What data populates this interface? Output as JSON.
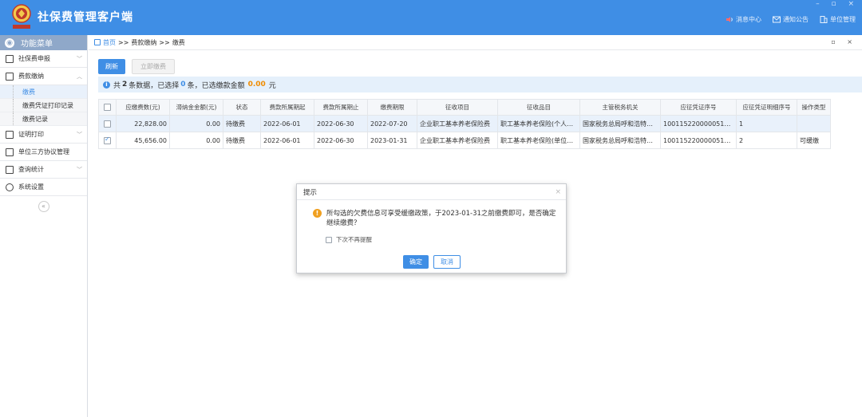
{
  "header": {
    "title": "社保费管理客户端",
    "window_controls": "– ▫ ×",
    "actions": [
      {
        "label": "消息中心",
        "icon": "bell-icon"
      },
      {
        "label": "通知公告",
        "icon": "mail-icon"
      },
      {
        "label": "单位管理",
        "icon": "building-icon"
      }
    ],
    "accent": "#3f8ee5"
  },
  "sidebar": {
    "title": "功能菜单",
    "items": [
      {
        "label": "社保费申报",
        "icon": "declare-icon",
        "expanded": false
      },
      {
        "label": "费款缴纳",
        "icon": "payment-icon",
        "expanded": true,
        "children": [
          {
            "label": "缴费",
            "current": true
          },
          {
            "label": "缴费凭证打印记录",
            "current": false
          },
          {
            "label": "缴费记录",
            "current": false
          }
        ]
      },
      {
        "label": "证明打印",
        "icon": "print-icon",
        "expanded": false
      },
      {
        "label": "单位三方协议管理",
        "icon": "agreement-icon",
        "expanded": false
      },
      {
        "label": "查询统计",
        "icon": "stats-icon",
        "expanded": false
      },
      {
        "label": "系统设置",
        "icon": "gear-icon",
        "expanded": false
      }
    ]
  },
  "breadcrumb": {
    "home": "首页",
    "sep": ">>",
    "level1": "费款缴纳",
    "level2": "缴费",
    "panel_controls": "▫ ×"
  },
  "toolbar": {
    "refresh": "刷新",
    "pay_now": "立即缴费"
  },
  "summary": {
    "prefix": "共",
    "total": "2",
    "mid1": "条数据，已选择",
    "selected": "0",
    "mid2": "条，已选缴款金额",
    "amount": "0.00",
    "suffix": "元"
  },
  "table": {
    "columns": [
      "应缴费数(元)",
      "滞纳金金额(元)",
      "状态",
      "费款所属期起",
      "费款所属期止",
      "缴费期限",
      "征收项目",
      "征收品目",
      "主管税务机关",
      "应征凭证序号",
      "应征凭证明细序号",
      "操作类型"
    ],
    "rows": [
      {
        "checked": false,
        "highlight": true,
        "cells": [
          "22,828.00",
          "0.00",
          "待缴费",
          "2022-06-01",
          "2022-06-30",
          "2022-07-20",
          "企业职工基本养老保险费",
          "职工基本养老保险(个人缴纳)",
          "国家税务总局呼和浩特市新...",
          "1001152200000515...",
          "1",
          ""
        ]
      },
      {
        "checked": true,
        "highlight": false,
        "cells": [
          "45,656.00",
          "0.00",
          "待缴费",
          "2022-06-01",
          "2022-06-30",
          "2023-01-31",
          "企业职工基本养老保险费",
          "职工基本养老保险(单位缴纳)",
          "国家税务总局呼和浩特市新...",
          "1001152200000515...",
          "2",
          "可缓缴"
        ]
      }
    ]
  },
  "dialog": {
    "title": "提示",
    "message": "所勾选的欠费信息可享受缓缴政策，于2023-01-31之前缴费即可，是否确定继续缴费？",
    "checkbox_label": "下次不再提醒",
    "ok": "确定",
    "cancel": "取消"
  }
}
